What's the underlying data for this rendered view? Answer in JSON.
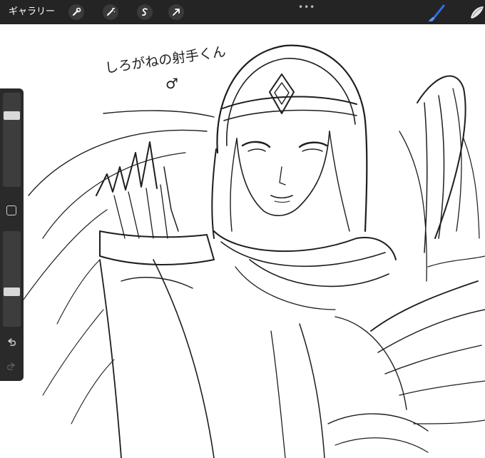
{
  "toolbar": {
    "gallery_label": "ギャラリー",
    "tools": [
      {
        "name": "wrench-icon"
      },
      {
        "name": "magic-wand-icon"
      },
      {
        "name": "selection-icon"
      },
      {
        "name": "transform-arrow-icon"
      }
    ],
    "more_label": "•••",
    "active_tool": "brush-icon",
    "active_color": "#2f6ff0"
  },
  "sidebar": {
    "brush_size_level": 0.78,
    "opacity_level": 0.35
  },
  "canvas": {
    "caption_line1": "しろがねの射手くん",
    "caption_line2": "♂"
  }
}
